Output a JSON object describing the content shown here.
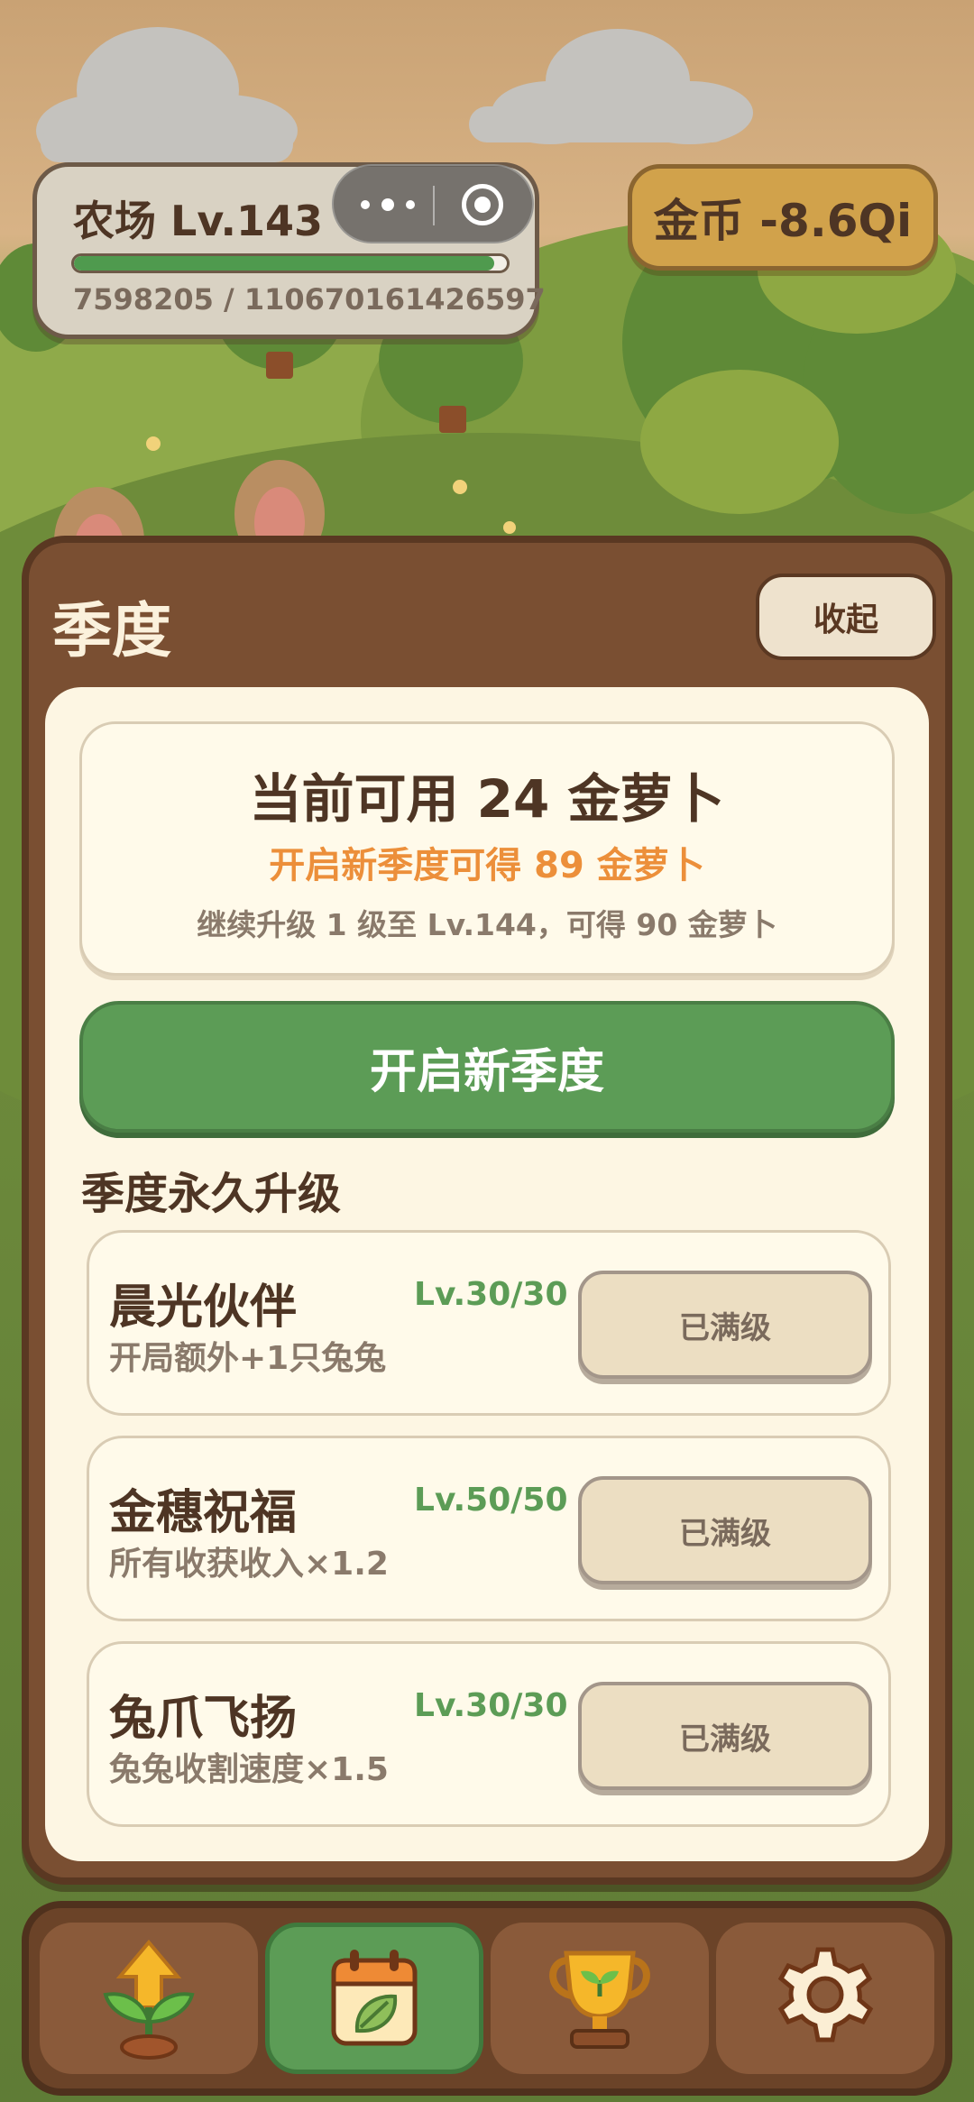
{
  "hud": {
    "level_label": "农场 Lv.143",
    "xp_text": "7598205 / 110670161426597",
    "xp_fraction": 0.97,
    "coin_label": "金币 -8.6Qi"
  },
  "panel": {
    "title": "季度",
    "collapse_label": "收起",
    "current_available": "当前可用 24 金萝卜",
    "new_season_gain": "开启新季度可得 89 金萝卜",
    "upgrade_note": "继续升级 1 级至 Lv.144，可得 90 金萝卜",
    "start_button_label": "开启新季度",
    "section_title": "季度永久升级",
    "upgrades": [
      {
        "name": "晨光伙伴",
        "desc": "开局额外+1只兔兔",
        "level": "Lv.30/30",
        "button": "已满级"
      },
      {
        "name": "金穗祝福",
        "desc": "所有收获收入×1.2",
        "level": "Lv.50/50",
        "button": "已满级"
      },
      {
        "name": "兔爪飞扬",
        "desc": "兔兔收割速度×1.5",
        "level": "Lv.30/30",
        "button": "已满级"
      }
    ]
  },
  "nav": {
    "items": [
      {
        "icon": "sprout-upgrade-icon",
        "active": false
      },
      {
        "icon": "calendar-leaf-icon",
        "active": true
      },
      {
        "icon": "trophy-icon",
        "active": false
      },
      {
        "icon": "gear-icon",
        "active": false
      }
    ]
  },
  "colors": {
    "accent_green": "#5c9c56",
    "accent_orange": "#ec8f3a",
    "panel_brown": "#7a4f32",
    "coin_gold": "#d1a24b"
  }
}
